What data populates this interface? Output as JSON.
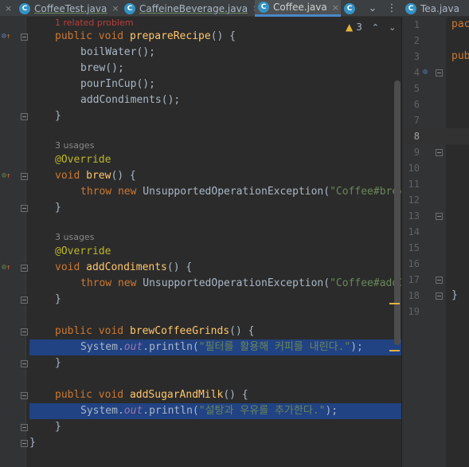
{
  "tabs": [
    {
      "label": "CoffeeTest.java",
      "icon": "c-class-icon",
      "active": false
    },
    {
      "label": "CaffeineBeverage.java",
      "icon": "c-class-icon",
      "active": false
    },
    {
      "label": "Coffee.java",
      "icon": "c-class-icon",
      "active": true
    },
    {
      "label": "",
      "icon": "c-class-icon",
      "active": false
    },
    {
      "label": "Tea.java",
      "icon": "c-class-icon",
      "active": false
    }
  ],
  "tab_close": "×",
  "tab_overflow": "⌄",
  "tab_menu": "⋮",
  "inspection": {
    "warning_count": "3",
    "up": "⌃",
    "down": "⌄"
  },
  "hints": {
    "related_problem": "1 related problem",
    "usages_brew": "3 usages",
    "usages_condiments": "3 usages"
  },
  "code": {
    "prepare_sig": [
      "public",
      "void",
      "prepareRecipe",
      "() {"
    ],
    "boil": "boilWater();",
    "brew_call": "brew();",
    "pour": "pourInCup();",
    "add": "addCondiments();",
    "close": "}",
    "override": "@Override",
    "brew_sig": [
      "void",
      "brew",
      "() {"
    ],
    "throw1": [
      "throw",
      "new",
      "UnsupportedOperationException(",
      "\"Coffee#brew\");"
    ],
    "cond_sig": [
      "void",
      "addCondiments",
      "() {"
    ],
    "throw2": [
      "throw",
      "new",
      "UnsupportedOperationException(",
      "\"Coffee#addCondiments\");"
    ],
    "grinds_sig": [
      "public",
      "void",
      "brewCoffeeGrinds",
      "() {"
    ],
    "println1": [
      "System.",
      "out",
      ".println(",
      "\"필터를 활용해 커피를 내린다.\"",
      ");"
    ],
    "milk_sig": [
      "public",
      "void",
      "addSugarAndMilk",
      "() {"
    ],
    "println2": [
      "System.",
      "out",
      ".println(",
      "\"설탕과 우유를 추가한다.\"",
      ");"
    ]
  },
  "right_pane": {
    "line_numbers": [
      "1",
      "2",
      "3",
      "4",
      "5",
      "6",
      "7",
      "8",
      "9",
      "10",
      "11",
      "12",
      "13",
      "14",
      "15",
      "16",
      "17",
      "18",
      "19"
    ],
    "current_line": "8",
    "line1": "pac",
    "line3": "pub",
    "line18": "}"
  }
}
